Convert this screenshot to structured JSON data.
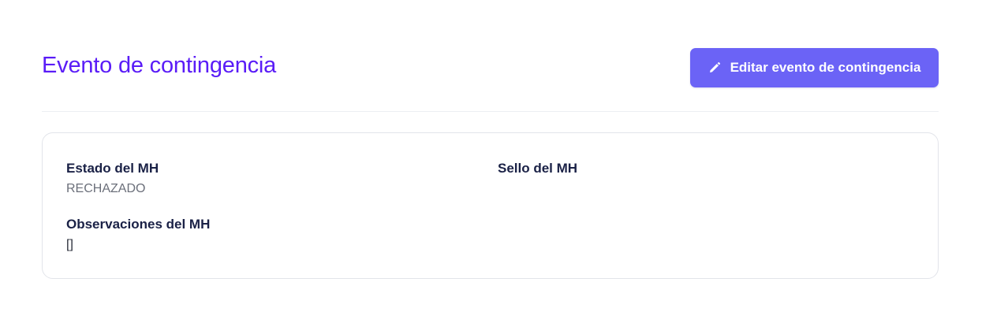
{
  "header": {
    "title": "Evento de contingencia",
    "edit_button_label": "Editar evento de contingencia",
    "edit_button_icon": "pencil-icon"
  },
  "details": {
    "estado": {
      "label": "Estado del MH",
      "value": "RECHAZADO"
    },
    "sello": {
      "label": "Sello del MH",
      "value": ""
    },
    "observaciones": {
      "label": "Observaciones del MH",
      "value": "[]"
    }
  },
  "colors": {
    "title": "#5a1cf7",
    "button_bg": "#6b63f6",
    "button_text": "#ffffff",
    "label": "#1a2146",
    "value": "#6b6f7a"
  }
}
